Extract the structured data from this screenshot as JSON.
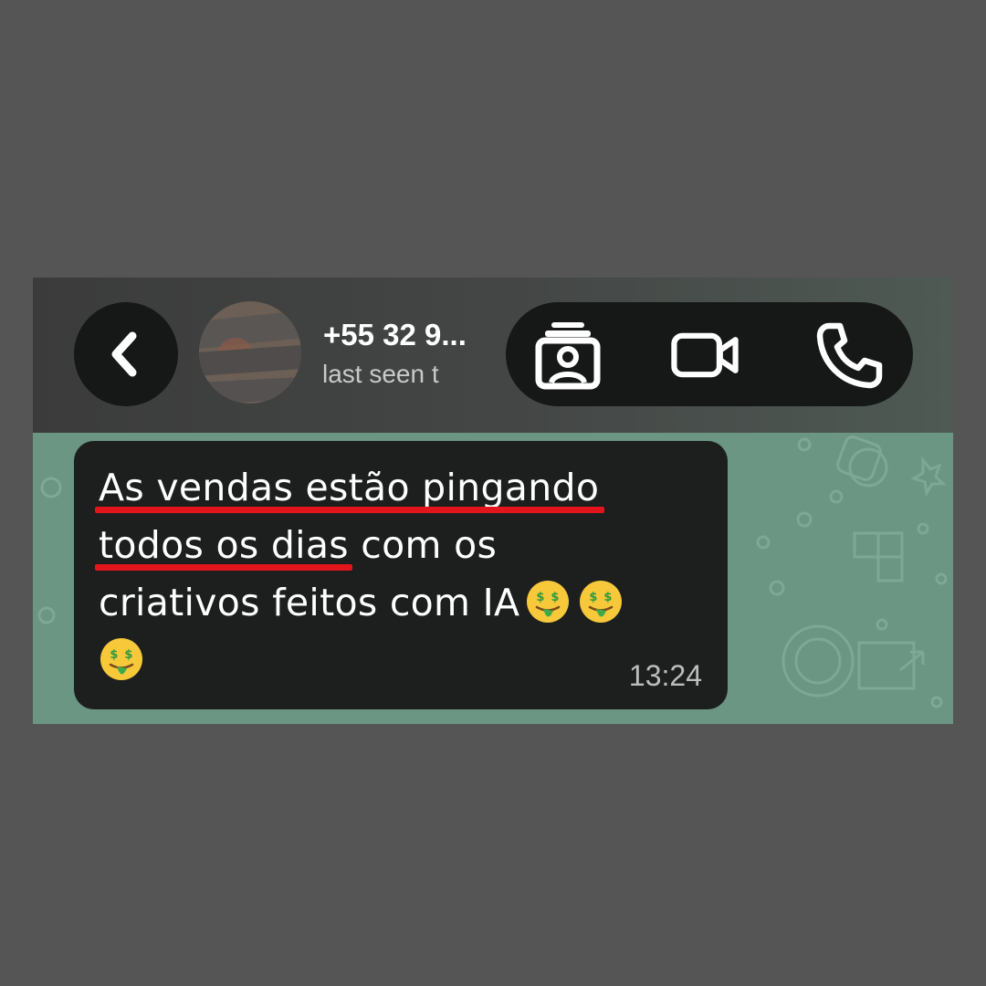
{
  "header": {
    "contact_name": "+55 32 9...",
    "contact_status": "last seen t",
    "icons": {
      "back": "back-arrow-icon",
      "avatar": "blurred-avatar",
      "catalog": "contact-card-stack-icon",
      "video": "video-camera-icon",
      "call": "phone-icon"
    }
  },
  "message": {
    "line1": "As vendas estão pingando",
    "line2_highlight": "todos os dias",
    "line2_rest": " com os",
    "line3": "criativos feitos com IA",
    "emoji": "money-mouth-face",
    "time": "13:24"
  },
  "colors": {
    "background": "#555555",
    "chat_wallpaper": "#6b9684",
    "bubble": "#1d1f1f",
    "underline": "#e3141c"
  }
}
